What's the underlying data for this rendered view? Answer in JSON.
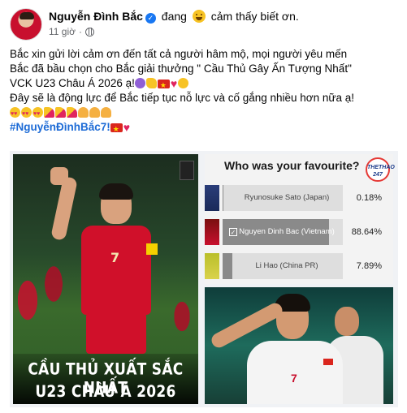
{
  "post": {
    "author": "Nguyễn Đình Bắc",
    "feeling_prefix": "đang",
    "feeling": "cảm thấy biết ơn.",
    "time": "11 giờ",
    "privacy_icon": "globe-icon",
    "lines": [
      "Bắc xin gửi lời cảm ơn đến tất cả người hâm mộ, mọi người yêu mến",
      "Bắc đã bầu chọn cho Bắc giải thưởng \" Cầu Thủ Gây Ấn Tượng Nhất\"",
      "VCK U23 Châu Á 2026 ạ!",
      "Đây sẽ là động lực để Bắc tiếp tục nỗ lực và cố gắng nhiều hơn nữa ạ!"
    ],
    "hashtag": "#NguyễnĐìnhBắc7!"
  },
  "media": {
    "left_caption_line1": "CẦU THỦ XUẤT SẮC NHẤT",
    "left_caption_line2": "U23 CHÂU Á 2026",
    "left_jersey_number": "7",
    "poll": {
      "title": "Who was your favourite?",
      "logo_text": "THETHAO 247",
      "options": [
        {
          "label": "Ryunosuke Sato (Japan)",
          "percent_text": "0.18%",
          "percent": 0.18,
          "selected": false
        },
        {
          "label": "Nguyen Dinh Bac (Vietnam)",
          "percent_text": "88.64%",
          "percent": 88.64,
          "selected": true
        },
        {
          "label": "Li Hao (China PR)",
          "percent_text": "7.89%",
          "percent": 7.89,
          "selected": false
        }
      ]
    },
    "right_jersey_number": "7"
  },
  "colors": {
    "verified": "#1877f2",
    "hashtag": "#1d6bd6",
    "meta_text": "#65676b",
    "vn_red": "#c8102e"
  }
}
